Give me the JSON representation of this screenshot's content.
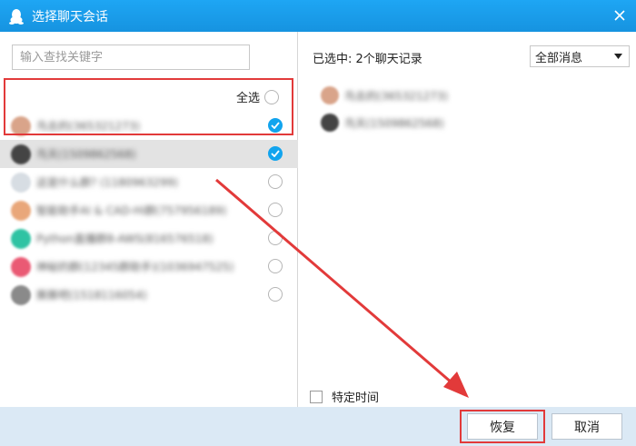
{
  "window": {
    "title": "选择聊天会话",
    "app_icon": "penguin-icon",
    "close_icon": "close-icon"
  },
  "colors": {
    "titlebar": "#1693e0",
    "accent": "#12a4ee",
    "highlight_box": "#e23a3a",
    "footer": "#dbe9f5"
  },
  "search": {
    "placeholder": "输入查找关键字",
    "value": ""
  },
  "select_all": {
    "label": "全选",
    "checked": false
  },
  "contacts": [
    {
      "name": "鸟去的(365321273)",
      "checked": true,
      "avatar_color": "#d9a48a"
    },
    {
      "name": "鸟天(1509862568)",
      "checked": true,
      "avatar_color": "#444444"
    },
    {
      "name": "这是什么群? (1180963299)",
      "checked": false,
      "avatar_color": "#d7dde3"
    },
    {
      "name": "智能助手AI & CAD-Hi群(757956189)",
      "checked": false,
      "avatar_color": "#e9a77a"
    },
    {
      "name": "Python直播群8-AWS(816576518)",
      "checked": false,
      "avatar_color": "#2fc3a3"
    },
    {
      "name": "神秘的群(12345群助手)(1036947525)",
      "checked": false,
      "avatar_color": "#ea5a74"
    },
    {
      "name": "撕撕吧(1518116054)",
      "checked": false,
      "avatar_color": "#8a8a8a"
    }
  ],
  "summary": {
    "text": "已选中: 2个聊天记录"
  },
  "filter": {
    "selected": "全部消息",
    "icon": "caret-down-icon"
  },
  "selected_items": [
    {
      "name": "鸟去的(365321273)",
      "avatar_color": "#d9a48a"
    },
    {
      "name": "鸟天(1509862568)",
      "avatar_color": "#444444"
    }
  ],
  "specific_time": {
    "label": "特定时间",
    "checked": false
  },
  "buttons": {
    "restore": "恢复",
    "cancel": "取消"
  }
}
